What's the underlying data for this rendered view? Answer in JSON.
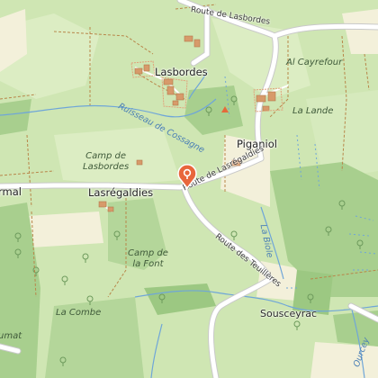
{
  "map": {
    "colors": {
      "background": "#cfe6b3",
      "meadow": "#dcedc3",
      "forest": "#a8cf8e",
      "field": "#f3f0da",
      "road_fill": "#ffffff",
      "road_casing": "#c9c9c9",
      "water": "#6fa6d8",
      "path": "#b8864a",
      "building": "#d79a6a",
      "pin": "#e8663c"
    },
    "labels": {
      "route_de_lasbordes": "Route de Lasbordes",
      "lasbordes": "Lasbordes",
      "al_cayrefour": "Al Cayrefour",
      "ruisseau_de_cossagne": "Ruisseau de Cossagne",
      "la_lande": "La Lande",
      "piganiol": "Piganiol",
      "camp_de_lasbordes_1": "Camp de",
      "camp_de_lasbordes_2": "Lasbordes",
      "route_de_lasregaldies": "Route de Lasrégaldies",
      "rmal": "rmal",
      "lasregaldies": "Lasrégaldies",
      "camp_de_la_font_1": "Camp de",
      "camp_de_la_font_2": "la Font",
      "la_biole": "La Biole",
      "route_des_teuilleres": "Route des Teuillères",
      "la_combe": "La Combe",
      "souscey_ac": "Sousceyrac",
      "ourcey": "Ourcey",
      "umat": "umat"
    },
    "marker": {
      "icon": "location-pin-icon"
    }
  }
}
